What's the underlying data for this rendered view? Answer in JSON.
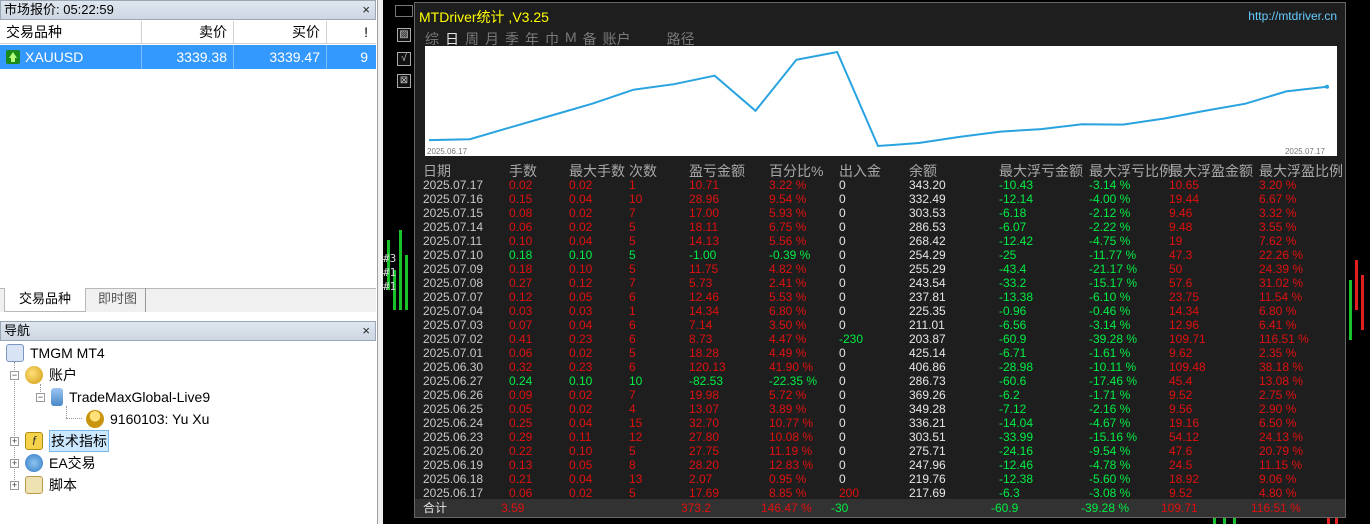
{
  "market_watch": {
    "title": "市场报价: 05:22:59",
    "close": "×",
    "columns": [
      "交易品种",
      "卖价",
      "买价",
      "!"
    ],
    "row": {
      "symbol": "XAUUSD",
      "bid": "3339.38",
      "ask": "3339.47",
      "spread": "9"
    },
    "tabs": [
      "交易品种",
      "即时图"
    ]
  },
  "navigator": {
    "title": "导航",
    "close": "×",
    "root": "TMGM MT4",
    "accounts": "账户",
    "server": "TradeMaxGlobal-Live9",
    "user": "9160103: Yu Xu",
    "indicators": "技术指标",
    "experts": "EA交易",
    "scripts": "脚本"
  },
  "chart": {
    "edge_labels": [
      "#3",
      "#1",
      "#1"
    ],
    "side_buttons": [
      "▨",
      "√",
      "⊠"
    ]
  },
  "panel": {
    "title": "MTDriver统计 ,V3.25",
    "url": "http://mtdriver.cn",
    "tabs": [
      "综",
      "日",
      "周",
      "月",
      "季",
      "年",
      "巾",
      "M",
      "备",
      "账户"
    ],
    "active_tab": "日",
    "route_label": "路径",
    "graph_start_date": "2025.06.17",
    "graph_end_date": "2025.07.17",
    "columns": [
      "日期",
      "手数",
      "最大手数",
      "次数",
      "盈亏金额",
      "百分比%",
      "出入金",
      "余额",
      "最大浮亏金额",
      "最大浮亏比例",
      "最大浮盈金额",
      "最大浮盈比例"
    ],
    "rows": [
      {
        "date": "2025.07.17",
        "lots": "0.02",
        "max_lots": "0.02",
        "count": "1",
        "pl": "10.71",
        "pct": "3.22 %",
        "flow": "0",
        "balance": "343.20",
        "max_fl": "-10.43",
        "max_fl_pct": "-3.14 %",
        "max_fp": "10.65",
        "max_fp_pct": "3.20 %"
      },
      {
        "date": "2025.07.16",
        "lots": "0.15",
        "max_lots": "0.04",
        "count": "10",
        "pl": "28.96",
        "pct": "9.54 %",
        "flow": "0",
        "balance": "332.49",
        "max_fl": "-12.14",
        "max_fl_pct": "-4.00 %",
        "max_fp": "19.44",
        "max_fp_pct": "6.67 %"
      },
      {
        "date": "2025.07.15",
        "lots": "0.08",
        "max_lots": "0.02",
        "count": "7",
        "pl": "17.00",
        "pct": "5.93 %",
        "flow": "0",
        "balance": "303.53",
        "max_fl": "-6.18",
        "max_fl_pct": "-2.12 %",
        "max_fp": "9.46",
        "max_fp_pct": "3.32 %"
      },
      {
        "date": "2025.07.14",
        "lots": "0.06",
        "max_lots": "0.02",
        "count": "5",
        "pl": "18.11",
        "pct": "6.75 %",
        "flow": "0",
        "balance": "286.53",
        "max_fl": "-6.07",
        "max_fl_pct": "-2.22 %",
        "max_fp": "9.48",
        "max_fp_pct": "3.55 %"
      },
      {
        "date": "2025.07.11",
        "lots": "0.10",
        "max_lots": "0.04",
        "count": "5",
        "pl": "14.13",
        "pct": "5.56 %",
        "flow": "0",
        "balance": "268.42",
        "max_fl": "-12.42",
        "max_fl_pct": "-4.75 %",
        "max_fp": "19",
        "max_fp_pct": "7.62 %"
      },
      {
        "date": "2025.07.10",
        "lots": "0.18",
        "max_lots": "0.10",
        "count": "5",
        "pl": "-1.00",
        "pct": "-0.39 %",
        "flow": "0",
        "balance": "254.29",
        "max_fl": "-25",
        "max_fl_pct": "-11.77 %",
        "max_fp": "47.3",
        "max_fp_pct": "22.26 %"
      },
      {
        "date": "2025.07.09",
        "lots": "0.18",
        "max_lots": "0.10",
        "count": "5",
        "pl": "11.75",
        "pct": "4.82 %",
        "flow": "0",
        "balance": "255.29",
        "max_fl": "-43.4",
        "max_fl_pct": "-21.17 %",
        "max_fp": "50",
        "max_fp_pct": "24.39 %"
      },
      {
        "date": "2025.07.08",
        "lots": "0.27",
        "max_lots": "0.12",
        "count": "7",
        "pl": "5.73",
        "pct": "2.41 %",
        "flow": "0",
        "balance": "243.54",
        "max_fl": "-33.2",
        "max_fl_pct": "-15.17 %",
        "max_fp": "57.6",
        "max_fp_pct": "31.02 %"
      },
      {
        "date": "2025.07.07",
        "lots": "0.12",
        "max_lots": "0.05",
        "count": "6",
        "pl": "12.46",
        "pct": "5.53 %",
        "flow": "0",
        "balance": "237.81",
        "max_fl": "-13.38",
        "max_fl_pct": "-6.10 %",
        "max_fp": "23.75",
        "max_fp_pct": "11.54 %"
      },
      {
        "date": "2025.07.04",
        "lots": "0.03",
        "max_lots": "0.03",
        "count": "1",
        "pl": "14.34",
        "pct": "6.80 %",
        "flow": "0",
        "balance": "225.35",
        "max_fl": "-0.96",
        "max_fl_pct": "-0.46 %",
        "max_fp": "14.34",
        "max_fp_pct": "6.80 %"
      },
      {
        "date": "2025.07.03",
        "lots": "0.07",
        "max_lots": "0.04",
        "count": "6",
        "pl": "7.14",
        "pct": "3.50 %",
        "flow": "0",
        "balance": "211.01",
        "max_fl": "-6.56",
        "max_fl_pct": "-3.14 %",
        "max_fp": "12.96",
        "max_fp_pct": "6.41 %"
      },
      {
        "date": "2025.07.02",
        "lots": "0.41",
        "max_lots": "0.23",
        "count": "6",
        "pl": "8.73",
        "pct": "4.47 %",
        "flow": "-230",
        "balance": "203.87",
        "max_fl": "-60.9",
        "max_fl_pct": "-39.28 %",
        "max_fp": "109.71",
        "max_fp_pct": "116.51 %"
      },
      {
        "date": "2025.07.01",
        "lots": "0.06",
        "max_lots": "0.02",
        "count": "5",
        "pl": "18.28",
        "pct": "4.49 %",
        "flow": "0",
        "balance": "425.14",
        "max_fl": "-6.71",
        "max_fl_pct": "-1.61 %",
        "max_fp": "9.62",
        "max_fp_pct": "2.35 %"
      },
      {
        "date": "2025.06.30",
        "lots": "0.32",
        "max_lots": "0.23",
        "count": "6",
        "pl": "120.13",
        "pct": "41.90 %",
        "flow": "0",
        "balance": "406.86",
        "max_fl": "-28.98",
        "max_fl_pct": "-10.11 %",
        "max_fp": "109.48",
        "max_fp_pct": "38.18 %"
      },
      {
        "date": "2025.06.27",
        "lots": "0.24",
        "max_lots": "0.10",
        "count": "10",
        "pl": "-82.53",
        "pct": "-22.35 %",
        "flow": "0",
        "balance": "286.73",
        "max_fl": "-60.6",
        "max_fl_pct": "-17.46 %",
        "max_fp": "45.4",
        "max_fp_pct": "13.08 %"
      },
      {
        "date": "2025.06.26",
        "lots": "0.09",
        "max_lots": "0.02",
        "count": "7",
        "pl": "19.98",
        "pct": "5.72 %",
        "flow": "0",
        "balance": "369.26",
        "max_fl": "-6.2",
        "max_fl_pct": "-1.71 %",
        "max_fp": "9.52",
        "max_fp_pct": "2.75 %"
      },
      {
        "date": "2025.06.25",
        "lots": "0.05",
        "max_lots": "0.02",
        "count": "4",
        "pl": "13.07",
        "pct": "3.89 %",
        "flow": "0",
        "balance": "349.28",
        "max_fl": "-7.12",
        "max_fl_pct": "-2.16 %",
        "max_fp": "9.56",
        "max_fp_pct": "2.90 %"
      },
      {
        "date": "2025.06.24",
        "lots": "0.25",
        "max_lots": "0.04",
        "count": "15",
        "pl": "32.70",
        "pct": "10.77 %",
        "flow": "0",
        "balance": "336.21",
        "max_fl": "-14.04",
        "max_fl_pct": "-4.67 %",
        "max_fp": "19.16",
        "max_fp_pct": "6.50 %"
      },
      {
        "date": "2025.06.23",
        "lots": "0.29",
        "max_lots": "0.11",
        "count": "12",
        "pl": "27.80",
        "pct": "10.08 %",
        "flow": "0",
        "balance": "303.51",
        "max_fl": "-33.99",
        "max_fl_pct": "-15.16 %",
        "max_fp": "54.12",
        "max_fp_pct": "24.13 %"
      },
      {
        "date": "2025.06.20",
        "lots": "0.22",
        "max_lots": "0.10",
        "count": "5",
        "pl": "27.75",
        "pct": "11.19 %",
        "flow": "0",
        "balance": "275.71",
        "max_fl": "-24.16",
        "max_fl_pct": "-9.54 %",
        "max_fp": "47.6",
        "max_fp_pct": "20.79 %"
      },
      {
        "date": "2025.06.19",
        "lots": "0.13",
        "max_lots": "0.05",
        "count": "8",
        "pl": "28.20",
        "pct": "12.83 %",
        "flow": "0",
        "balance": "247.96",
        "max_fl": "-12.46",
        "max_fl_pct": "-4.78 %",
        "max_fp": "24.5",
        "max_fp_pct": "11.15 %"
      },
      {
        "date": "2025.06.18",
        "lots": "0.21",
        "max_lots": "0.04",
        "count": "13",
        "pl": "2.07",
        "pct": "0.95 %",
        "flow": "0",
        "balance": "219.76",
        "max_fl": "-12.38",
        "max_fl_pct": "-5.60 %",
        "max_fp": "18.92",
        "max_fp_pct": "9.06 %"
      },
      {
        "date": "2025.06.17",
        "lots": "0.06",
        "max_lots": "0.02",
        "count": "5",
        "pl": "17.69",
        "pct": "8.85 %",
        "flow": "200",
        "balance": "217.69",
        "max_fl": "-6.3",
        "max_fl_pct": "-3.08 %",
        "max_fp": "9.52",
        "max_fp_pct": "4.80 %"
      }
    ],
    "total": {
      "label": "合计",
      "lots": "3.59",
      "pl": "373.2",
      "pct": "146.47 %",
      "flow": "-30",
      "max_fl": "-60.9",
      "max_fl_pct": "-39.28 %",
      "max_fp": "109.71",
      "max_fp_pct": "116.51 %"
    },
    "colors": {
      "positive": "#e01010",
      "negative": "#00ee44",
      "curve": "#29a3e0",
      "title": "#ffff00",
      "url": "#66ccff"
    }
  }
}
